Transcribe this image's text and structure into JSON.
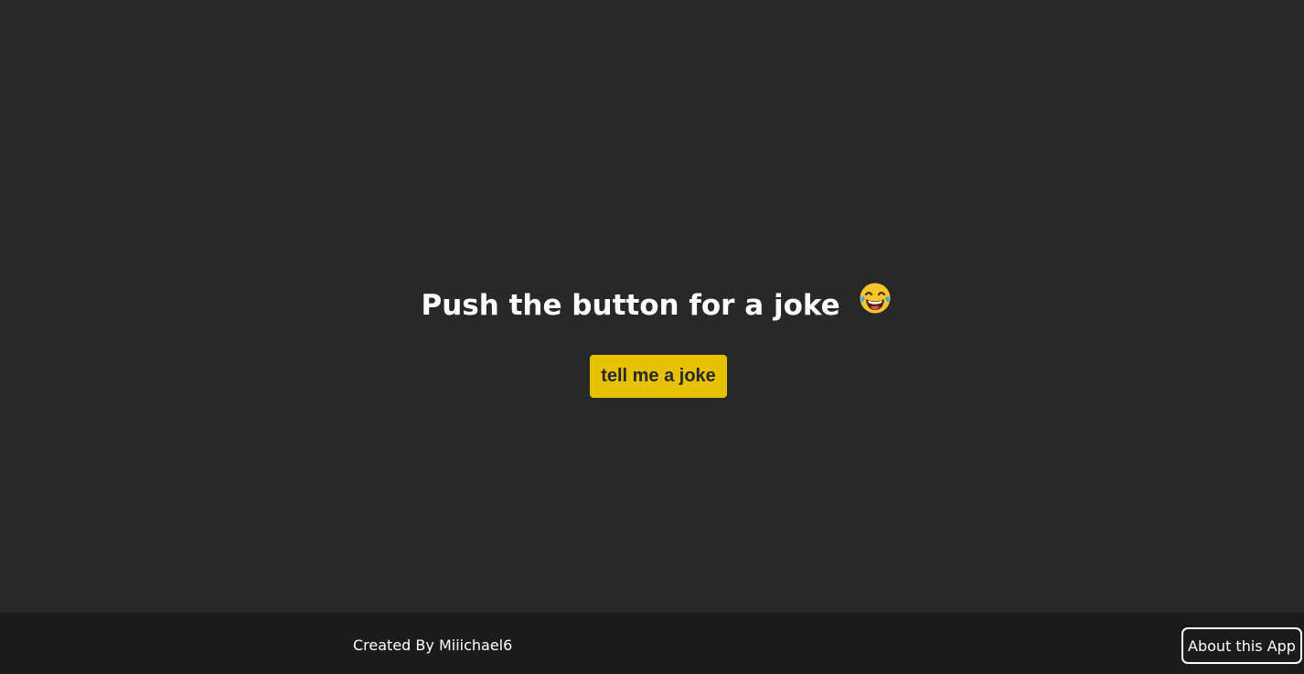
{
  "main": {
    "heading": "Push the button for a joke",
    "emoji": "😂",
    "button_label": "tell me a joke",
    "accent_color": "#e6c104"
  },
  "footer": {
    "credit": "Created By Miiichael6",
    "about_label": "About this App"
  },
  "icons": {
    "heading_emoji": "laughing-with-tears-icon"
  }
}
